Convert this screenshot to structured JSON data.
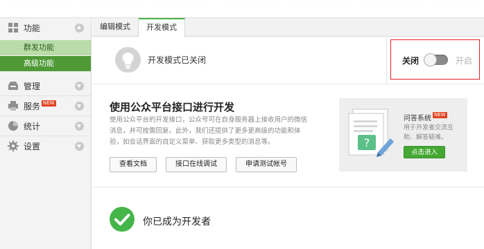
{
  "sidebar": {
    "items": [
      {
        "label": "功能",
        "icon": "grid-icon"
      },
      {
        "label": "管理",
        "icon": "inbox-icon"
      },
      {
        "label": "服务",
        "icon": "printer-icon",
        "badge": "NEW"
      },
      {
        "label": "统计",
        "icon": "pie-chart-icon"
      },
      {
        "label": "设置",
        "icon": "gear-icon"
      }
    ],
    "sub_items": [
      "群发功能",
      "高级功能"
    ]
  },
  "tabs": [
    "编辑模式",
    "开发模式"
  ],
  "dev_mode": {
    "status_text": "开发模式已关闭",
    "toggle_off_label": "关闭",
    "toggle_on_label": "开启",
    "enabled": false
  },
  "api": {
    "title": "使用公众平台接口进行开发",
    "description": "使用公众平台的开发接口，公众号可在自身服务器上接收用户的微信消息，并可按需回复。此外，我们还提供了更多更高级的功能和体验，如会话界面的自定义菜单、获取更多类型的消息等。",
    "buttons": [
      "查看文档",
      "接口在线调试",
      "申请测试帐号"
    ]
  },
  "qa": {
    "title": "问答系统",
    "badge": "NEW",
    "description": "用于开发者交流互助、解答疑难。",
    "button": "点击进入"
  },
  "developer_message": "你已成为开发者",
  "colors": {
    "accent_green": "#44b549",
    "active_sub_bg": "#4f9a37",
    "highlight_border": "#e02020"
  }
}
